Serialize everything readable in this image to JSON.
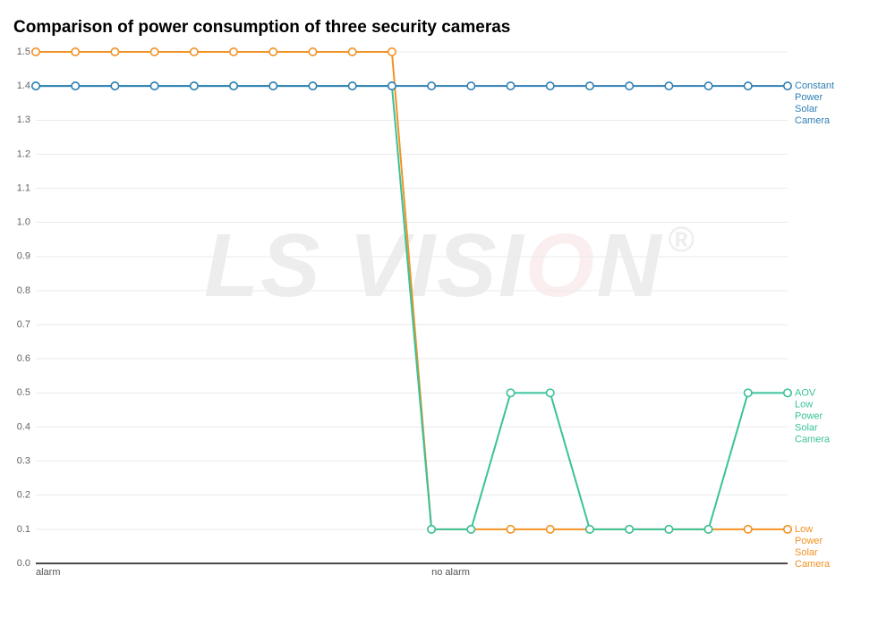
{
  "title": "Comparison of power consumption of three security cameras",
  "watermark": {
    "text1": "LS VISI",
    "textO": "O",
    "text3": "N",
    "reg": "®"
  },
  "chart_data": {
    "type": "line",
    "title": "Comparison of power consumption of three security cameras",
    "xlabel": "",
    "ylabel": "",
    "x_categories": [
      "alarm",
      "no alarm"
    ],
    "x_positions": {
      "alarm": 0,
      "no alarm": 10
    },
    "x_count": 20,
    "ylim": [
      0.0,
      1.5
    ],
    "yticks": [
      0.0,
      0.1,
      0.2,
      0.3,
      0.4,
      0.5,
      0.6,
      0.7,
      0.8,
      0.9,
      1.0,
      1.1,
      1.2,
      1.3,
      1.4,
      1.5
    ],
    "series": [
      {
        "name": "Constant Power Solar Camera",
        "color": "#2e7fb3",
        "label_lines": [
          "Constant",
          "Power",
          "Solar",
          "Camera"
        ],
        "values": [
          1.4,
          1.4,
          1.4,
          1.4,
          1.4,
          1.4,
          1.4,
          1.4,
          1.4,
          1.4,
          1.4,
          1.4,
          1.4,
          1.4,
          1.4,
          1.4,
          1.4,
          1.4,
          1.4,
          1.4
        ]
      },
      {
        "name": "AOV Low Power Solar Camera",
        "color": "#3ac29a",
        "label_lines": [
          "AOV",
          "Low",
          "Power",
          "Solar",
          "Camera"
        ],
        "values": [
          1.4,
          1.4,
          1.4,
          1.4,
          1.4,
          1.4,
          1.4,
          1.4,
          1.4,
          1.4,
          0.1,
          0.1,
          0.5,
          0.5,
          0.1,
          0.1,
          0.1,
          0.1,
          0.5,
          0.5
        ]
      },
      {
        "name": "Low Power Solar Camera",
        "color": "#f29224",
        "label_lines": [
          "Low",
          "Power",
          "Solar",
          "Camera"
        ],
        "values": [
          1.5,
          1.5,
          1.5,
          1.5,
          1.5,
          1.5,
          1.5,
          1.5,
          1.5,
          1.5,
          0.1,
          0.1,
          0.1,
          0.1,
          0.1,
          0.1,
          0.1,
          0.1,
          0.1,
          0.1
        ]
      }
    ]
  }
}
